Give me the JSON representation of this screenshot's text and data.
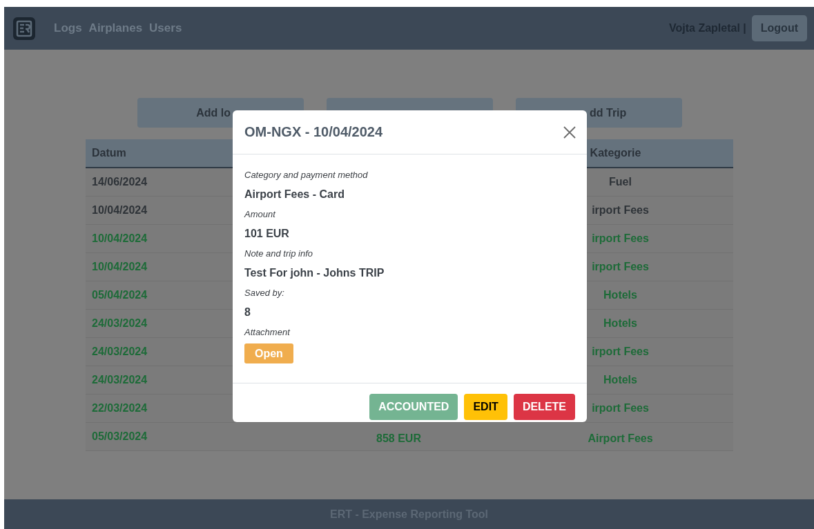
{
  "navbar": {
    "links": [
      "Logs",
      "Airplanes",
      "Users"
    ],
    "user": "Vojta Zapletal |",
    "logout": "Logout"
  },
  "actions": [
    {
      "kind": "labelled",
      "label": "Add lo"
    },
    {
      "kind": "blank"
    },
    {
      "kind": "labelled",
      "label": "dd Trip"
    }
  ],
  "table": {
    "columns": [
      {
        "kind": "titled",
        "title": "Datum"
      },
      {
        "kind": "blank"
      },
      {
        "kind": "titled",
        "title": "Kategorie"
      }
    ],
    "rows": [
      {
        "date": "14/06/2024",
        "category": "Fuel",
        "accounted": false
      },
      {
        "date": "10/04/2024",
        "category": "irport Fees",
        "accounted": false
      },
      {
        "date": "10/04/2024",
        "category": "irport Fees",
        "accounted": true
      },
      {
        "date": "10/04/2024",
        "category": "irport Fees",
        "accounted": true
      },
      {
        "date": "05/04/2024",
        "category": "Hotels",
        "accounted": true
      },
      {
        "date": "24/03/2024",
        "category": "Hotels",
        "accounted": true
      },
      {
        "date": "24/03/2024",
        "category": "irport Fees",
        "accounted": true
      },
      {
        "date": "24/03/2024",
        "category": "Hotels",
        "accounted": true
      },
      {
        "date": "22/03/2024",
        "category": "irport Fees",
        "accounted": true
      },
      {
        "date": "05/03/2024",
        "amount": "858 EUR",
        "category": "Airport Fees",
        "accounted": true
      }
    ]
  },
  "modal": {
    "title": "OM-NGX - 10/04/2024",
    "fields": [
      {
        "label": "Category and payment method",
        "value": "Airport Fees - Card",
        "kind": "text"
      },
      {
        "label": "Amount",
        "value": "101 EUR",
        "kind": "text"
      },
      {
        "label": "Note and trip info",
        "value": "Test For john - Johns TRIP",
        "kind": "text"
      },
      {
        "label": "Saved by:",
        "value": "8",
        "kind": "text"
      },
      {
        "label": "Attachment",
        "value": "Open",
        "kind": "button"
      }
    ],
    "buttons": [
      {
        "label": "ACCOUNTED",
        "kind": "success"
      },
      {
        "label": "EDIT",
        "kind": "warning"
      },
      {
        "label": "DELETE",
        "kind": "danger"
      }
    ]
  },
  "footer": "ERT - Expense Reporting Tool"
}
